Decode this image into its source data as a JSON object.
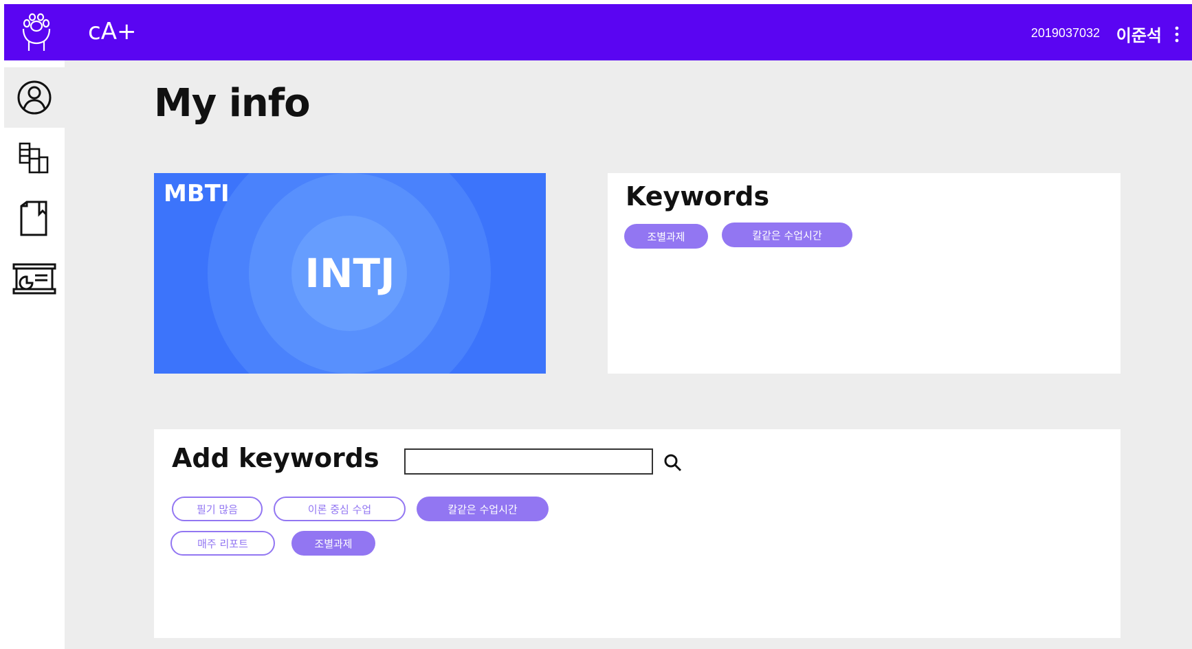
{
  "header": {
    "app_title": "cA+",
    "student_id": "2019037032",
    "user_name": "이준석"
  },
  "sidebar": {
    "items": [
      {
        "icon": "user-circle-icon",
        "active": true
      },
      {
        "icon": "layout-grid-icon",
        "active": false
      },
      {
        "icon": "bookmark-book-icon",
        "active": false
      },
      {
        "icon": "presentation-board-icon",
        "active": false
      }
    ]
  },
  "page": {
    "title": "My info"
  },
  "mbti": {
    "label": "MBTI",
    "value": "INTJ"
  },
  "keywords": {
    "heading": "Keywords",
    "chips": [
      "조별과제",
      "칼같은 수업시간"
    ]
  },
  "add_keywords": {
    "heading": "Add keywords",
    "search_value": "",
    "search_placeholder": "",
    "options": [
      {
        "label": "필기 많음",
        "selected": false
      },
      {
        "label": "이론 중심 수업",
        "selected": false
      },
      {
        "label": "칼같은 수업시간",
        "selected": true
      },
      {
        "label": "매주 리포트",
        "selected": false
      },
      {
        "label": "조별과제",
        "selected": true
      }
    ]
  },
  "colors": {
    "header": "#5a05f2",
    "mbti_card": "#3c74fb",
    "chip": "#9276f2",
    "background": "#ededed"
  }
}
